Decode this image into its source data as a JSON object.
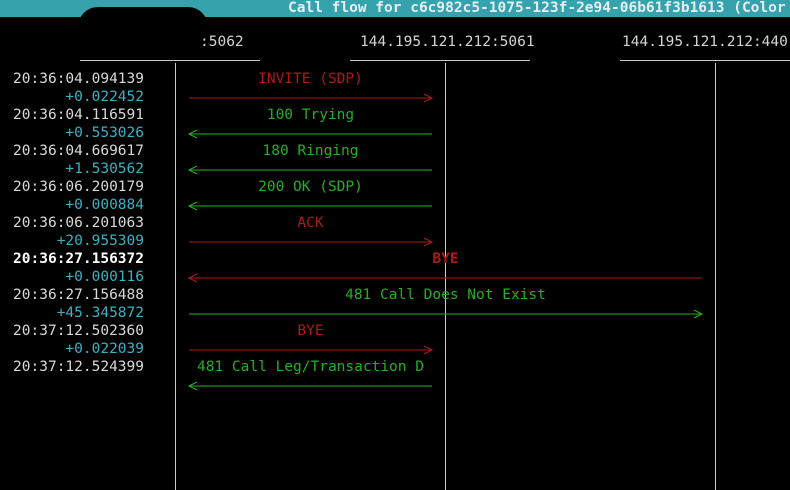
{
  "title": "Call flow for c6c982c5-1075-123f-2e94-06b61f3b1613 (Color",
  "hosts": [
    ":5062",
    "144.195.121.212:5061",
    "144.195.121.212:440"
  ],
  "colors": {
    "request": "#b01818",
    "response": "#22b022",
    "delta": "#3bb0c4",
    "titlebar": "#36a2ad"
  },
  "messages": [
    {
      "time": "20:36:04.094139",
      "delta": "+0.022452",
      "label": "INVITE (SDP)",
      "from": 0,
      "to": 1,
      "kind": "request",
      "bold_time": false
    },
    {
      "time": "20:36:04.116591",
      "delta": "+0.553026",
      "label": "100 Trying",
      "from": 1,
      "to": 0,
      "kind": "response",
      "bold_time": false
    },
    {
      "time": "20:36:04.669617",
      "delta": "+1.530562",
      "label": "180 Ringing",
      "from": 1,
      "to": 0,
      "kind": "response",
      "bold_time": false
    },
    {
      "time": "20:36:06.200179",
      "delta": "+0.000884",
      "label": "200 OK (SDP)",
      "from": 1,
      "to": 0,
      "kind": "response",
      "bold_time": false
    },
    {
      "time": "20:36:06.201063",
      "delta": "+20.955309",
      "label": "ACK",
      "from": 0,
      "to": 1,
      "kind": "request",
      "bold_time": false
    },
    {
      "time": "20:36:27.156372",
      "delta": "+0.000116",
      "label": "BYE",
      "from": 2,
      "to": 0,
      "kind": "request",
      "bold_time": true
    },
    {
      "time": "20:36:27.156488",
      "delta": "+45.345872",
      "label": "481 Call Does Not Exist",
      "from": 0,
      "to": 2,
      "kind": "response",
      "bold_time": false
    },
    {
      "time": "20:37:12.502360",
      "delta": "+0.022039",
      "label": "BYE",
      "from": 0,
      "to": 1,
      "kind": "request",
      "bold_time": false
    },
    {
      "time": "20:37:12.524399",
      "delta": "",
      "label": "481 Call Leg/Transaction D",
      "from": 1,
      "to": 0,
      "kind": "response",
      "bold_time": false
    }
  ]
}
